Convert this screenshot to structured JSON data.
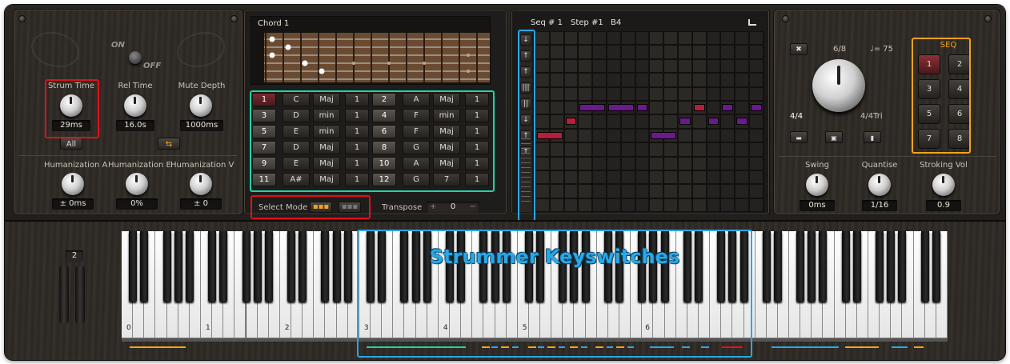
{
  "strummer": {
    "power": {
      "on_label": "ON",
      "off_label": "OFF"
    },
    "strum_time": {
      "label": "Strum Time",
      "value": "29ms"
    },
    "rel_time": {
      "label": "Rel Time",
      "value": "16.0s"
    },
    "mute_depth": {
      "label": "Mute Depth",
      "value": "1000ms"
    },
    "all_label": "All",
    "swap_icon": "⇆",
    "hum_a": {
      "label": "Humanization A",
      "value": "± 0ms"
    },
    "hum_e": {
      "label": "Humanization E",
      "value": "0%"
    },
    "hum_v": {
      "label": "Humanization V",
      "value": "± 0"
    }
  },
  "chord_display": {
    "title": "Chord 1"
  },
  "chord_grid": [
    [
      {
        "n": "1",
        "root": "C",
        "type": "Maj",
        "oct": "1"
      },
      {
        "n": "2",
        "root": "A",
        "type": "Maj",
        "oct": "1"
      }
    ],
    [
      {
        "n": "3",
        "root": "D",
        "type": "min",
        "oct": "1"
      },
      {
        "n": "4",
        "root": "F",
        "type": "min",
        "oct": "1"
      }
    ],
    [
      {
        "n": "5",
        "root": "E",
        "type": "min",
        "oct": "1"
      },
      {
        "n": "6",
        "root": "F",
        "type": "Maj",
        "oct": "1"
      }
    ],
    [
      {
        "n": "7",
        "root": "D",
        "type": "Maj",
        "oct": "1"
      },
      {
        "n": "8",
        "root": "G",
        "type": "Maj",
        "oct": "1"
      }
    ],
    [
      {
        "n": "9",
        "root": "E",
        "type": "Maj",
        "oct": "1"
      },
      {
        "n": "10",
        "root": "A",
        "type": "Maj",
        "oct": "1"
      }
    ],
    [
      {
        "n": "11",
        "root": "A#",
        "type": "Maj",
        "oct": "1"
      },
      {
        "n": "12",
        "root": "G",
        "type": "7",
        "oct": "1"
      }
    ]
  ],
  "select_mode": {
    "label": "Select Mode"
  },
  "transpose": {
    "label": "Transpose",
    "value": "0",
    "plus": "+",
    "minus": "−"
  },
  "sequencer": {
    "seq_label": "Seq # 1",
    "step_label": "Step #1",
    "note_label": "B4",
    "bars_icon": "bar-chart-icon"
  },
  "strum_arrows": [
    "↓",
    "↑",
    "↑",
    "|||",
    "||",
    "↓",
    "↑",
    "↑"
  ],
  "seq_panel": {
    "close": "✖",
    "time_sig": "6/8",
    "tempo": "♩= 75",
    "left_sig": "4/4",
    "right_sig": "4/4Tri",
    "seq_title": "SEQ",
    "seq_buttons": [
      "1",
      "2",
      "3",
      "4",
      "5",
      "6",
      "7",
      "8"
    ],
    "swing": {
      "label": "Swing",
      "value": "0ms"
    },
    "quantise": {
      "label": "Quantise",
      "value": "1/16"
    },
    "stroking": {
      "label": "Stroking Vol",
      "value": "0.9"
    }
  },
  "keyboard": {
    "title": "Strummer Keyswitches",
    "octave_display": "2",
    "octave_labels": [
      "0",
      "1",
      "2",
      "3",
      "4",
      "5",
      "6"
    ]
  },
  "colors": {
    "red": "#e0111b",
    "teal": "#1fd3a8",
    "blue": "#2aa7e6",
    "orange": "#f2a21e",
    "purple": "#6a1a8a",
    "crimson": "#b3203b"
  }
}
